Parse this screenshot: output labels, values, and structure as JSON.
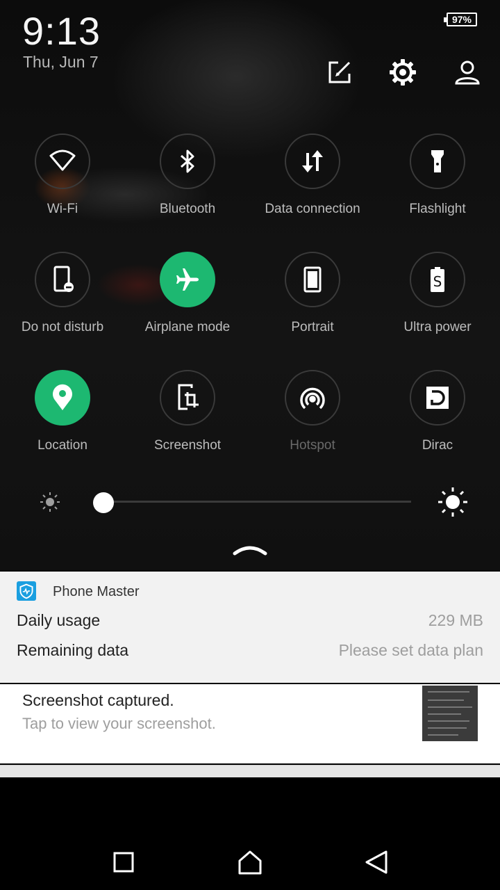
{
  "status": {
    "time": "9:13",
    "date": "Thu, Jun 7",
    "battery": "97%"
  },
  "header_icons": [
    "edit-icon",
    "settings-gear-icon",
    "user-profile-icon"
  ],
  "tiles": [
    {
      "label": "Wi-Fi",
      "icon": "wifi-icon",
      "active": false
    },
    {
      "label": "Bluetooth",
      "icon": "bluetooth-icon",
      "active": false
    },
    {
      "label": "Data connection",
      "icon": "data-arrows-icon",
      "active": false
    },
    {
      "label": "Flashlight",
      "icon": "flashlight-icon",
      "active": false
    },
    {
      "label": "Do not disturb",
      "icon": "do-not-disturb-icon",
      "active": false
    },
    {
      "label": "Airplane mode",
      "icon": "airplane-icon",
      "active": true
    },
    {
      "label": "Portrait",
      "icon": "portrait-rotation-icon",
      "active": false
    },
    {
      "label": "Ultra power",
      "icon": "ultra-power-icon",
      "active": false
    },
    {
      "label": "Location",
      "icon": "location-pin-icon",
      "active": true
    },
    {
      "label": "Screenshot",
      "icon": "screenshot-icon",
      "active": false
    },
    {
      "label": "Hotspot",
      "icon": "hotspot-icon",
      "active": false,
      "disabled": true
    },
    {
      "label": "Dirac",
      "icon": "dirac-icon",
      "active": false
    }
  ],
  "brightness": {
    "level": 0.0
  },
  "colors": {
    "accent": "#1db871",
    "panel_bg": "#121212",
    "notif_bg": "#f2f2f2"
  },
  "notifications": {
    "phone_master": {
      "app": "Phone Master",
      "rows": [
        {
          "label": "Daily usage",
          "value": "229 MB"
        },
        {
          "label": "Remaining data",
          "value": "Please set data plan"
        }
      ]
    },
    "screenshot": {
      "title": "Screenshot captured.",
      "subtitle": "Tap to view your screenshot."
    }
  },
  "nav": [
    "recents-square-icon",
    "home-icon",
    "back-triangle-icon"
  ]
}
